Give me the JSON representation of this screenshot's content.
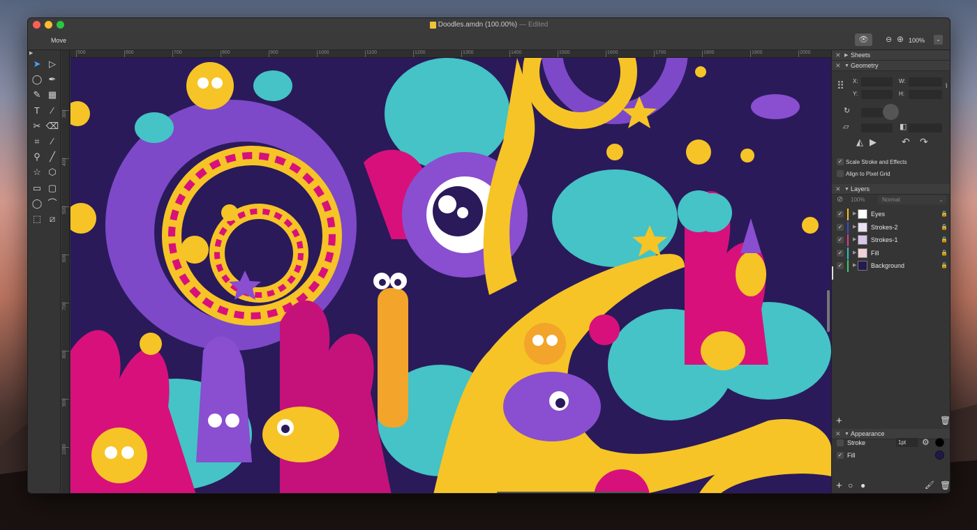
{
  "window": {
    "title": "Doodles.amdn (100.00%)",
    "edited": "— Edited"
  },
  "toolbar": {
    "tool_name": "Move",
    "zoom": "100%",
    "preview_icon": "eye-icon",
    "zoom_out_icon": "zoom-out-icon",
    "zoom_in_icon": "zoom-in-icon"
  },
  "tools": [
    {
      "name": "move-tool",
      "glyph": "➤",
      "selected": true
    },
    {
      "name": "direct-select-tool",
      "glyph": "▷"
    },
    {
      "name": "lasso-tool",
      "glyph": "◯"
    },
    {
      "name": "pen-tool",
      "glyph": "✒"
    },
    {
      "name": "brush-tool",
      "glyph": "✎"
    },
    {
      "name": "gradient-tool",
      "glyph": "▦"
    },
    {
      "name": "text-tool",
      "glyph": "T"
    },
    {
      "name": "eyedropper-tool",
      "glyph": "⁄"
    },
    {
      "name": "scissors-tool",
      "glyph": "✂"
    },
    {
      "name": "eraser-tool",
      "glyph": "⌫"
    },
    {
      "name": "crop-tool",
      "glyph": "⌗"
    },
    {
      "name": "picker-tool",
      "glyph": "⁄"
    },
    {
      "name": "zoom-tool",
      "glyph": "⚲"
    },
    {
      "name": "line-tool",
      "glyph": "╱"
    },
    {
      "name": "star-tool",
      "glyph": "☆"
    },
    {
      "name": "polygon-tool",
      "glyph": "⬡"
    },
    {
      "name": "rectangle-tool",
      "glyph": "▭"
    },
    {
      "name": "rounded-rect-tool",
      "glyph": "▢"
    },
    {
      "name": "ellipse-tool",
      "glyph": "◯"
    },
    {
      "name": "arc-tool",
      "glyph": "⌒"
    },
    {
      "name": "transform-tool",
      "glyph": "⬚"
    },
    {
      "name": "warp-tool",
      "glyph": "⧄"
    }
  ],
  "ruler": {
    "top": [
      "500",
      "600",
      "700",
      "800",
      "900",
      "1000",
      "1100",
      "1200",
      "1300",
      "1400",
      "1500",
      "1600",
      "1700",
      "1800",
      "1900",
      "2000"
    ],
    "left": [
      "300",
      "400",
      "500",
      "600",
      "700",
      "800",
      "900",
      "1000"
    ]
  },
  "panel": {
    "sheets": "Sheets",
    "geometry": "Geometry",
    "x_label": "X:",
    "y_label": "Y:",
    "w_label": "W:",
    "h_label": "H:",
    "scale_stroke": "Scale Stroke and Effects",
    "align_pixel": "Align to Pixel Grid",
    "layers_title": "Layers",
    "opacity": "100%",
    "blend_mode": "Normal",
    "layers": [
      {
        "name": "Eyes",
        "color": "#f3c21f",
        "thumb": "#ffffff"
      },
      {
        "name": "Strokes-2",
        "color": "#3b4bd8",
        "thumb": "#e8e2f2"
      },
      {
        "name": "Strokes-1",
        "color": "#d93a8e",
        "thumb": "#d8c6ec"
      },
      {
        "name": "Fill",
        "color": "#2fc0c9",
        "thumb": "#f1d0d8"
      },
      {
        "name": "Background",
        "color": "#43c96a",
        "thumb": "#241a4e"
      }
    ],
    "appearance": "Appearance",
    "stroke_label": "Stroke",
    "stroke_width": "1pt",
    "fill_label": "Fill",
    "stroke_color": "#000000",
    "fill_color": "#23164f"
  },
  "colors": {
    "bg": "#2a1a5a",
    "yellow": "#f6c426",
    "magenta": "#d8107b",
    "teal": "#45c3c6",
    "purple": "#8a4ed0"
  }
}
